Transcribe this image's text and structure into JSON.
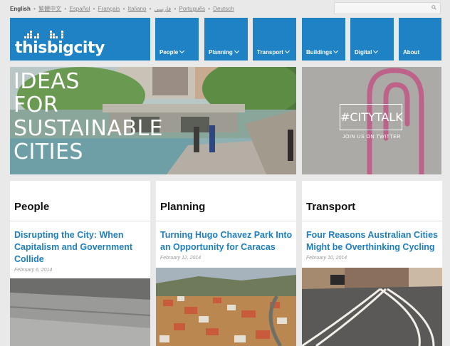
{
  "languages": {
    "current": "English",
    "others": [
      "繁體中文",
      "Español",
      "Français",
      "Italiano",
      "فارسی",
      "Português",
      "Deutsch"
    ]
  },
  "search": {
    "placeholder": ""
  },
  "logo": {
    "text": "thisbigcity"
  },
  "nav": [
    {
      "label": "People",
      "has_dropdown": true
    },
    {
      "label": "Planning",
      "has_dropdown": true
    },
    {
      "label": "Transport",
      "has_dropdown": true
    },
    {
      "label": "Buildings",
      "has_dropdown": true
    },
    {
      "label": "Digital",
      "has_dropdown": true
    },
    {
      "label": "About",
      "has_dropdown": false
    }
  ],
  "hero": {
    "lines": [
      "IDEAS",
      "FOR",
      "SUSTAINABLE",
      "CITIES"
    ]
  },
  "citytalk": {
    "tag": "#CITYTALK",
    "sub": "JOIN US ON TWITTER"
  },
  "cards": [
    {
      "category": "People",
      "title": "Disrupting the City: When Capitalism and Government Collide",
      "date": "February 6, 2014"
    },
    {
      "category": "Planning",
      "title": "Turning Hugo Chavez Park Into an Opportunity for Caracas",
      "date": "February 12, 2014"
    },
    {
      "category": "Transport",
      "title": "Four Reasons Australian Cities Might be Overthinking Cycling",
      "date": "February 10, 2014"
    }
  ],
  "colors": {
    "brand_blue": "#1e82c5",
    "link_blue": "#1e7fc0",
    "background": "#e9e9e9"
  }
}
